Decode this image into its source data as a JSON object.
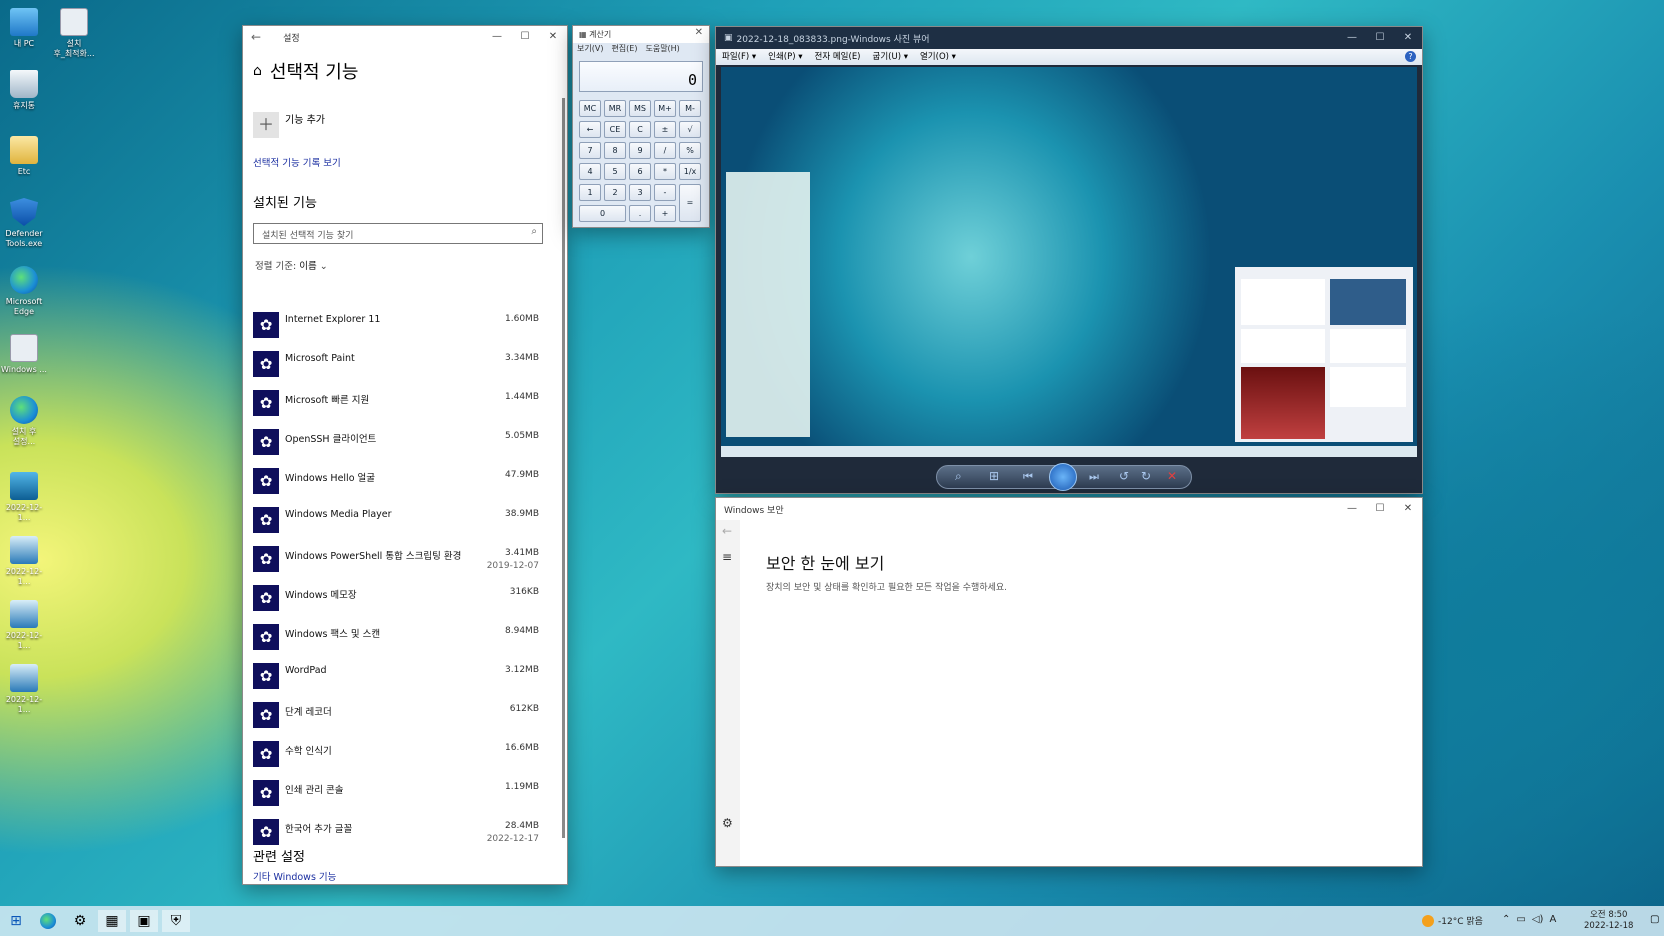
{
  "desktop": {
    "icons": [
      {
        "label": "내 PC"
      },
      {
        "label": "설치\n후_최적화..."
      },
      {
        "label": "휴지통"
      },
      {
        "label": "Etc"
      },
      {
        "label": "Defender\nTools.exe"
      },
      {
        "label": "Microsoft\nEdge"
      },
      {
        "label": "Windows ..."
      },
      {
        "label": "설치 후\n설정..."
      },
      {
        "label": "2022-12-1..."
      },
      {
        "label": "2022-12-1..."
      },
      {
        "label": "2022-12-1..."
      },
      {
        "label": "2022-12-1..."
      }
    ]
  },
  "settings": {
    "window_title": "설정",
    "page_title": "선택적 기능",
    "add_feature": "기능 추가",
    "history_link": "선택적 기능 기록 보기",
    "installed_heading": "설치된 기능",
    "search_placeholder": "설치된 선택적 기능 찾기",
    "sort_label": "정렬 기준:",
    "sort_value": "이름",
    "features": [
      {
        "name": "Internet Explorer 11",
        "size": "1.60MB",
        "date": ""
      },
      {
        "name": "Microsoft Paint",
        "size": "3.34MB",
        "date": ""
      },
      {
        "name": "Microsoft 빠른 지원",
        "size": "1.44MB",
        "date": ""
      },
      {
        "name": "OpenSSH 클라이언트",
        "size": "5.05MB",
        "date": ""
      },
      {
        "name": "Windows Hello 얼굴",
        "size": "47.9MB",
        "date": ""
      },
      {
        "name": "Windows Media Player",
        "size": "38.9MB",
        "date": ""
      },
      {
        "name": "Windows PowerShell 통합 스크립팅 환경",
        "size": "3.41MB",
        "date": "2019-12-07"
      },
      {
        "name": "Windows 메모장",
        "size": "316KB",
        "date": ""
      },
      {
        "name": "Windows 팩스 및 스캔",
        "size": "8.94MB",
        "date": ""
      },
      {
        "name": "WordPad",
        "size": "3.12MB",
        "date": ""
      },
      {
        "name": "단계 레코더",
        "size": "612KB",
        "date": ""
      },
      {
        "name": "수학 인식기",
        "size": "16.6MB",
        "date": ""
      },
      {
        "name": "인쇄 관리 콘솔",
        "size": "1.19MB",
        "date": ""
      },
      {
        "name": "한국어 추가 글꼴",
        "size": "28.4MB",
        "date": "2022-12-17"
      }
    ],
    "related_heading": "관련 설정",
    "related_link": "기타 Windows 기능"
  },
  "calculator": {
    "title": "계산기",
    "menu": [
      "보기(V)",
      "편집(E)",
      "도움말(H)"
    ],
    "display": "0",
    "rows": [
      [
        "MC",
        "MR",
        "MS",
        "M+",
        "M-"
      ],
      [
        "←",
        "CE",
        "C",
        "±",
        "√"
      ],
      [
        "7",
        "8",
        "9",
        "/",
        "%"
      ],
      [
        "4",
        "5",
        "6",
        "*",
        "1/x"
      ],
      [
        "1",
        "2",
        "3",
        "-",
        "="
      ],
      [
        "0",
        ".",
        "+"
      ]
    ]
  },
  "photo_viewer": {
    "title": "2022-12-18_083833.png-Windows 사진 뷰어",
    "menu": [
      "파일(F) ▾",
      "인쇄(P) ▾",
      "전자 메일(E)",
      "굽기(U) ▾",
      "열기(O) ▾"
    ]
  },
  "security": {
    "title": "Windows 보안",
    "heading": "보안 한 눈에 보기",
    "subtext": "장치의 보안 및 상태를 확인하고 필요한 모든 작업을 수행하세요."
  },
  "taskbar": {
    "weather": "-12°C 맑음",
    "ime": "A",
    "time": "오전 8:50",
    "date": "2022-12-18"
  },
  "colors": {
    "accent": "#0f0f5c",
    "link": "#1a2ea0"
  }
}
